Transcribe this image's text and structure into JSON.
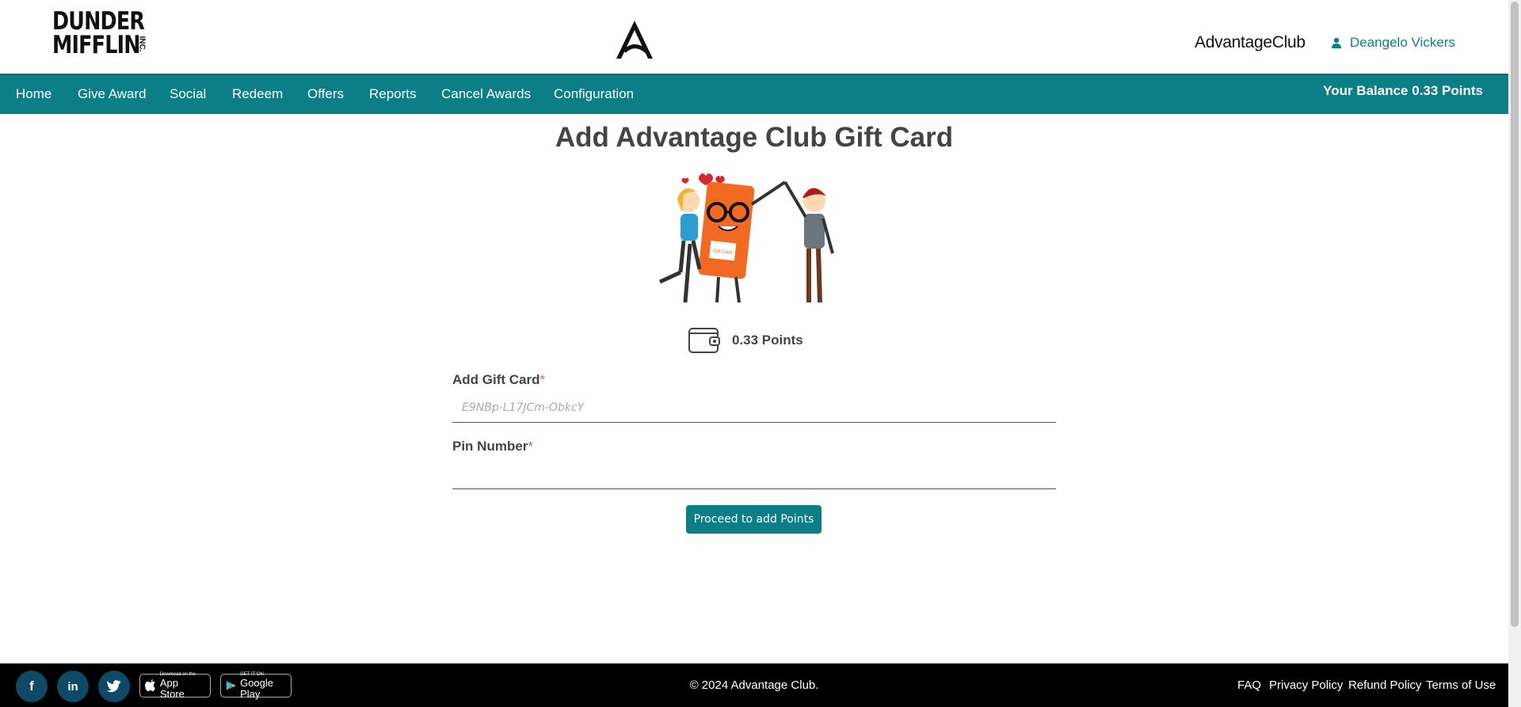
{
  "header": {
    "logo_line1": "DUNDER",
    "logo_line2": "MIFFLIN",
    "logo_inc": "INC.",
    "app_name": "AdvantageClub",
    "user_name": "Deangelo Vickers"
  },
  "nav": {
    "items": [
      {
        "label": "Home"
      },
      {
        "label": "Give Award"
      },
      {
        "label": "Social"
      },
      {
        "label": "Redeem"
      },
      {
        "label": "Offers"
      },
      {
        "label": "Reports"
      },
      {
        "label": "Cancel Awards"
      },
      {
        "label": "Configuration"
      }
    ],
    "balance": "Your Balance 0.33 Points"
  },
  "main": {
    "title": "Add Advantage Club Gift Card",
    "illustration_card_text": "Gift Card",
    "points": "0.33 Points",
    "gift_card_label": "Add Gift Card",
    "gift_card_placeholder": "E9NBp-L17JCm-ObkcY",
    "pin_label": "Pin Number",
    "pin_placeholder": "",
    "required_mark": "*",
    "submit_label": "Proceed to add Points"
  },
  "footer": {
    "social": [
      {
        "icon": "facebook-icon",
        "glyph": "f"
      },
      {
        "icon": "linkedin-icon",
        "glyph": "in"
      },
      {
        "icon": "twitter-icon",
        "glyph": "🐦"
      }
    ],
    "app_store_small": "Download on the",
    "app_store_big": "App Store",
    "google_play_small": "GET IT ON",
    "google_play_big": "Google Play",
    "copyright": "© 2024 Advantage Club.",
    "links": [
      {
        "label": "FAQ"
      },
      {
        "label": "Privacy Policy"
      },
      {
        "label": "Refund Policy"
      },
      {
        "label": "Terms of Use"
      }
    ]
  },
  "colors": {
    "accent": "#0b7e86",
    "footer_bg": "#000000",
    "title_text": "#444444"
  }
}
